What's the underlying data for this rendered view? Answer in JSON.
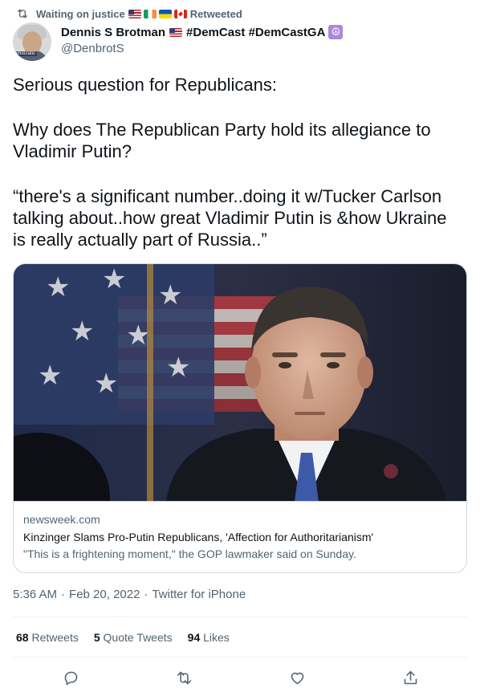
{
  "retweet_header": {
    "prefix": "Waiting on justice",
    "flags": [
      "us-flag",
      "ireland-flag",
      "ukraine-flag",
      "canada-flag"
    ],
    "suffix": "Retweeted"
  },
  "author": {
    "name": "Dennis S Brotman",
    "name_suffix": "#DemCast #DemCastGA",
    "handle": "@DenbrotS",
    "avatar_tag": "emocratic"
  },
  "tweet": {
    "paragraphs": [
      "Serious question for Republicans:",
      "Why does The Republican Party hold its allegiance to Vladimir Putin?",
      "“there's a significant number..doing it w/Tucker Carlson talking about..how great Vladimir Putin is &how Ukraine is really actually part of Russia..”"
    ]
  },
  "card": {
    "domain": "newsweek.com",
    "title": "Kinzinger Slams Pro-Putin Republicans, 'Affection for Authoritarianism'",
    "description": "\"This is a frightening moment,\" the GOP lawmaker said on Sunday."
  },
  "meta": {
    "time": "5:36 AM",
    "date": "Feb 20, 2022",
    "source": "Twitter for iPhone",
    "separator": "·"
  },
  "stats": {
    "retweets_count": "68",
    "retweets_label": "Retweets",
    "quotes_count": "5",
    "quotes_label": "Quote Tweets",
    "likes_count": "94",
    "likes_label": "Likes"
  },
  "actions": [
    "reply-icon",
    "retweet-icon",
    "like-icon",
    "share-icon"
  ],
  "colors": {
    "text_primary": "#0f1419",
    "text_secondary": "#536471",
    "border": "#cfd9de",
    "divider": "#eff3f4",
    "peace_badge": "#a78bdb"
  }
}
